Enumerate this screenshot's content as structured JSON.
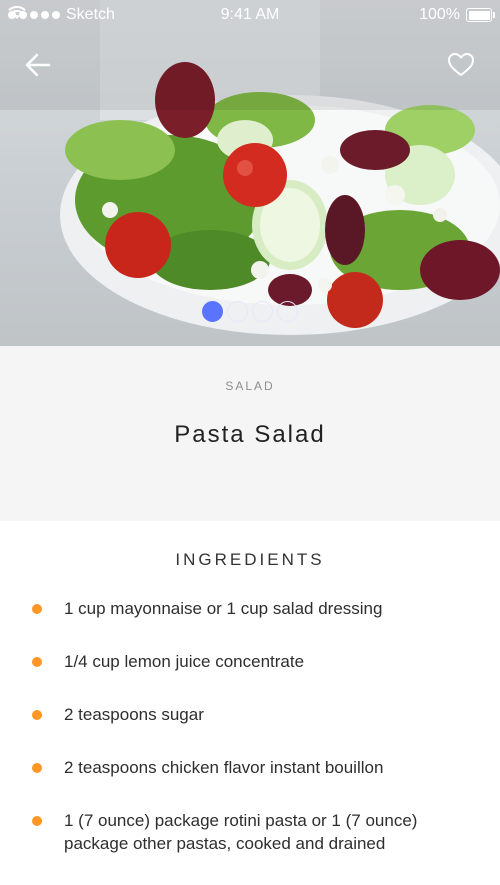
{
  "status_bar": {
    "carrier": "Sketch",
    "time": "9:41 AM",
    "battery": "100%"
  },
  "hero": {
    "image_description_icon": "salad-photo",
    "back_icon": "arrow-left-icon",
    "favorite_icon": "heart-outline-icon",
    "pager": {
      "count": 4,
      "active_index": 0
    },
    "colors": {
      "pager_active": "#5b74ff"
    }
  },
  "recipe": {
    "category": "SALAD",
    "title": "Pasta Salad"
  },
  "ingredients": {
    "heading": "INGREDIENTS",
    "bullet_color": "#ff9625",
    "items": [
      "1 cup mayonnaise or 1 cup salad dressing",
      "1/4 cup lemon juice concentrate",
      "2 teaspoons sugar",
      "2 teaspoons chicken flavor instant bouillon",
      "1 (7 ounce) package rotini pasta or 1 (7 ounce) package other pastas, cooked and drained"
    ]
  }
}
